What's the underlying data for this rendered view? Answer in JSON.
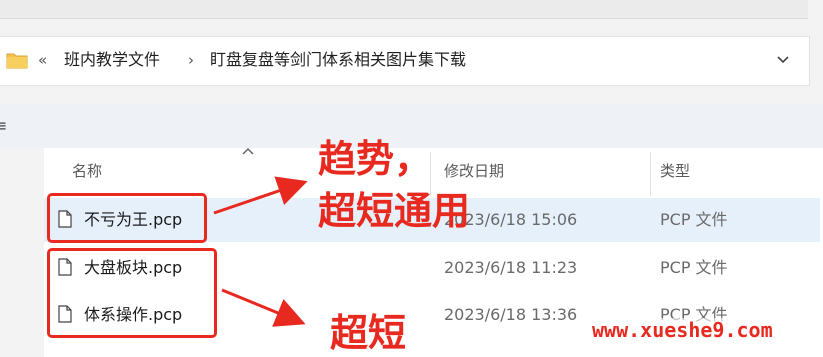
{
  "breadcrumb": {
    "overflow": "«",
    "segments": [
      "班内教学文件",
      "盯盘复盘等剑门体系相关图片集下载"
    ],
    "separator": "›"
  },
  "sidebar_glyph": "≡",
  "columns": {
    "name": "名称",
    "modified": "修改日期",
    "type": "类型"
  },
  "files": [
    {
      "name": "不亏为王.pcp",
      "modified": "2023/6/18 15:06",
      "type": "PCP 文件",
      "selected": true
    },
    {
      "name": "大盘板块.pcp",
      "modified": "2023/6/18 11:23",
      "type": "PCP 文件",
      "selected": false
    },
    {
      "name": "体系操作.pcp",
      "modified": "2023/6/18 13:36",
      "type": "PCP 文件",
      "selected": false
    }
  ],
  "annotations": {
    "top_line1": "趋势，",
    "top_line2": "超短通用",
    "bottom": "超短"
  },
  "watermark": "www.xueshe9.com",
  "colors": {
    "annotation_red": "#e8291f",
    "selected_row": "#e5f0fb",
    "folder": "#f3c24d"
  },
  "icons": [
    "folder-icon",
    "chevron-down-icon",
    "sort-up-icon",
    "file-icon",
    "arrow-icon"
  ]
}
